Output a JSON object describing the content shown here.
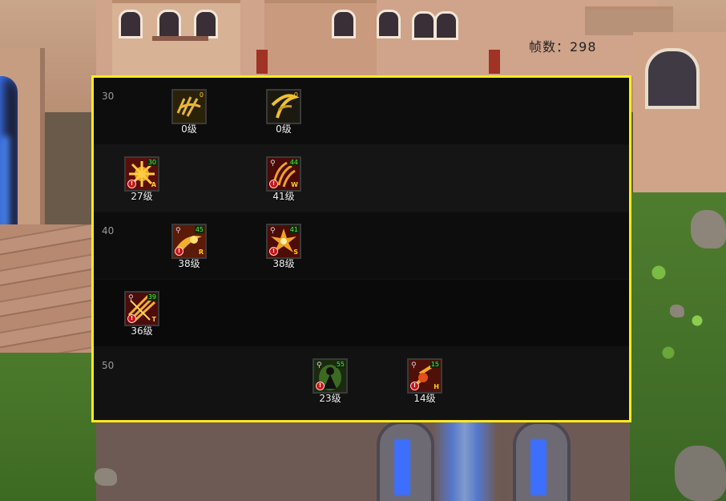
{
  "fps": {
    "label": "帧数：298"
  },
  "panel": {
    "rows": [
      {
        "level_label": "30"
      },
      {
        "level_label": ""
      },
      {
        "level_label": "40"
      },
      {
        "level_label": ""
      },
      {
        "level_label": "50"
      }
    ],
    "skills": [
      {
        "id": "skill-1",
        "level": "0级",
        "req": "0",
        "key": "",
        "locked": false,
        "theme": "gold-claw"
      },
      {
        "id": "skill-2",
        "level": "0级",
        "req": "0",
        "key": "",
        "locked": false,
        "theme": "gold-slash"
      },
      {
        "id": "skill-3",
        "level": "27级",
        "req": "30",
        "key": "A",
        "locked": true,
        "theme": "fire-burst"
      },
      {
        "id": "skill-4",
        "level": "41级",
        "req": "44",
        "key": "W",
        "locked": true,
        "theme": "fire-claw"
      },
      {
        "id": "skill-5",
        "level": "38级",
        "req": "45",
        "key": "R",
        "locked": true,
        "theme": "fire-wave"
      },
      {
        "id": "skill-6",
        "level": "38级",
        "req": "41",
        "key": "S",
        "locked": true,
        "theme": "fire-explode"
      },
      {
        "id": "skill-7",
        "level": "36级",
        "req": "39",
        "key": "T",
        "locked": true,
        "theme": "fire-blades"
      },
      {
        "id": "skill-8",
        "level": "23级",
        "req": "55",
        "key": "",
        "locked": true,
        "theme": "green-spirit"
      },
      {
        "id": "skill-9",
        "level": "14级",
        "req": "15",
        "key": "H",
        "locked": true,
        "theme": "fire-strike"
      }
    ]
  },
  "colors": {
    "panel_border": "#ffeb1a",
    "req_text": "#6be24a",
    "key_text": "#ffd21a"
  }
}
